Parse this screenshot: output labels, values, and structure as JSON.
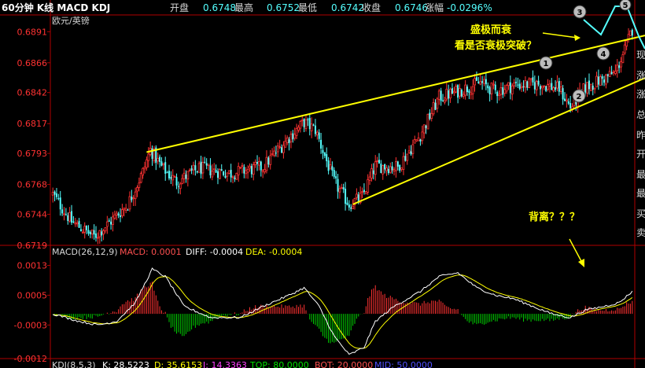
{
  "header": {
    "title": "60分钟 K线 MACD KDJ",
    "symbol": "欧元/英镑",
    "open_label": "开盘",
    "open_value": "0.6748",
    "high_label": "最高",
    "high_value": "0.6752",
    "low_label": "最低",
    "low_value": "0.6742",
    "close_label": "收盘",
    "close_value": "0.6746",
    "change_label": "涨幅",
    "change_value": "-0.0296%"
  },
  "annotations": {
    "text1": "盛极而衰",
    "text2": "看是否衰极突破？",
    "divergence": "背离？？？",
    "markers": [
      "1",
      "2",
      "3",
      "4",
      "5"
    ]
  },
  "right_strip": [
    "现",
    "涨",
    "涨",
    "总",
    "昨",
    "开",
    "最",
    "最",
    "买",
    "卖"
  ],
  "macd_legend": {
    "name": "MACD(26,12,9)",
    "macd": "MACD: 0.0001",
    "diff": "DIFF: -0.0004",
    "dea": "DEA: -0.0004"
  },
  "kdj_legend": {
    "name": "KDJ(8,5,3)",
    "k": "K: 28.5223",
    "d": "D: 35.6153",
    "j": "J: 14.3363",
    "top": "TOP: 80.0000",
    "bot": "BOT: 20.0000",
    "mid": "MID: 50.0000"
  },
  "colors": {
    "up": "#ff3232",
    "down": "#54ffff",
    "axis": "#b00000",
    "trend": "#ffff00",
    "hist_up": "#ff3232",
    "hist_down": "#00d000",
    "diff": "#ffffff",
    "dea": "#ffff00"
  },
  "chart_data": [
    {
      "type": "candlestick",
      "ylim": [
        0.6719,
        0.6895
      ],
      "yticks": [
        "0.6891",
        "0.6866",
        "0.6842",
        "0.6817",
        "0.6793",
        "0.6768",
        "0.6744",
        "0.6719"
      ],
      "waypoints": [
        [
          0,
          0.676
        ],
        [
          10,
          0.6738
        ],
        [
          22,
          0.6726
        ],
        [
          30,
          0.6737
        ],
        [
          40,
          0.6752
        ],
        [
          48,
          0.6778
        ],
        [
          52,
          0.6796
        ],
        [
          58,
          0.6782
        ],
        [
          66,
          0.677
        ],
        [
          78,
          0.6781
        ],
        [
          95,
          0.6777
        ],
        [
          112,
          0.6782
        ],
        [
          126,
          0.6806
        ],
        [
          134,
          0.6818
        ],
        [
          140,
          0.6812
        ],
        [
          150,
          0.677
        ],
        [
          158,
          0.6752
        ],
        [
          165,
          0.6758
        ],
        [
          172,
          0.6783
        ],
        [
          184,
          0.6782
        ],
        [
          196,
          0.6808
        ],
        [
          206,
          0.6838
        ],
        [
          216,
          0.6843
        ],
        [
          228,
          0.685
        ],
        [
          236,
          0.6843
        ],
        [
          246,
          0.6848
        ],
        [
          260,
          0.6849
        ],
        [
          270,
          0.6845
        ],
        [
          276,
          0.683
        ],
        [
          284,
          0.6846
        ],
        [
          292,
          0.6852
        ],
        [
          300,
          0.6858
        ],
        [
          306,
          0.688
        ],
        [
          309,
          0.6893
        ]
      ],
      "trendlines": [
        {
          "from": [
            50,
            0.6794
          ],
          "to": [
            330,
            0.6893
          ]
        },
        {
          "from": [
            160,
            0.6752
          ],
          "to": [
            330,
            0.6863
          ]
        }
      ]
    },
    {
      "type": "macd",
      "ylim": [
        -0.0012,
        0.0015
      ],
      "yticks": [
        "0.0013",
        "0.0005",
        "-0.0003",
        "-0.0012"
      ],
      "diff_waypoints": [
        [
          0,
          0.0
        ],
        [
          14,
          -0.0002
        ],
        [
          24,
          -0.0003
        ],
        [
          34,
          -0.0002
        ],
        [
          44,
          0.0003
        ],
        [
          50,
          0.0009
        ],
        [
          53,
          0.0012
        ],
        [
          60,
          0.001
        ],
        [
          70,
          0.0002
        ],
        [
          84,
          -0.0001
        ],
        [
          100,
          -0.0001
        ],
        [
          112,
          0.0002
        ],
        [
          126,
          0.0005
        ],
        [
          134,
          0.0007
        ],
        [
          142,
          0.0002
        ],
        [
          150,
          -0.0006
        ],
        [
          158,
          -0.0011
        ],
        [
          166,
          -0.0009
        ],
        [
          172,
          -0.0002
        ],
        [
          182,
          0.0002
        ],
        [
          196,
          0.0006
        ],
        [
          206,
          0.001
        ],
        [
          216,
          0.0011
        ],
        [
          226,
          0.0007
        ],
        [
          236,
          0.0005
        ],
        [
          246,
          0.0004
        ],
        [
          256,
          0.0002
        ],
        [
          266,
          0.0
        ],
        [
          276,
          -0.0001
        ],
        [
          284,
          0.0001
        ],
        [
          294,
          0.0002
        ],
        [
          302,
          0.0003
        ],
        [
          309,
          0.0006
        ]
      ],
      "dea_lag": 5
    }
  ]
}
